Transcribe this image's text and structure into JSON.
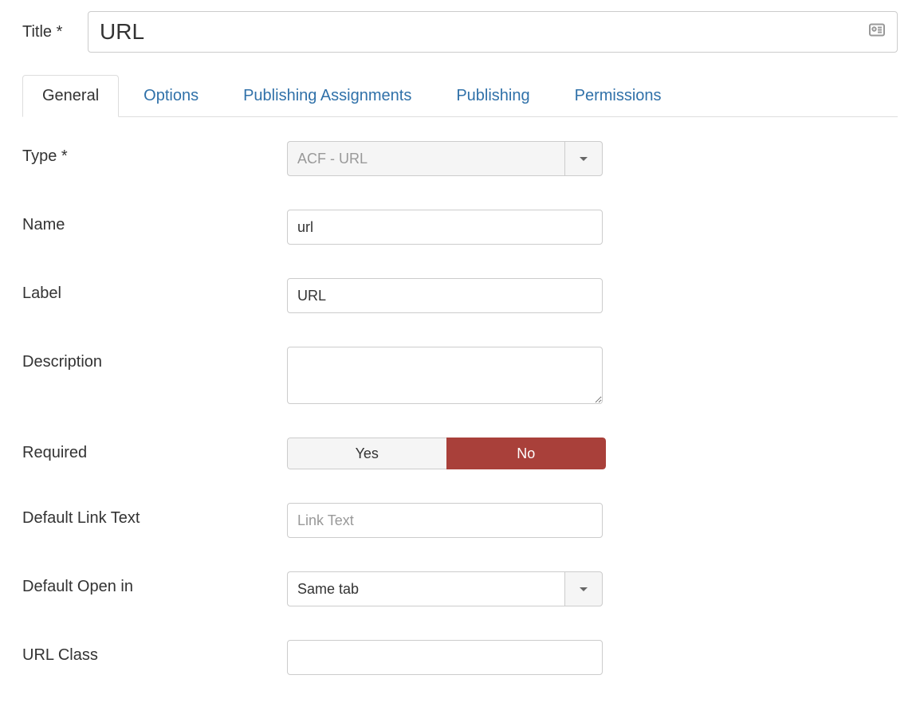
{
  "title": {
    "label": "Title *",
    "value": "URL"
  },
  "tabs": [
    {
      "label": "General",
      "active": true
    },
    {
      "label": "Options",
      "active": false
    },
    {
      "label": "Publishing Assignments",
      "active": false
    },
    {
      "label": "Publishing",
      "active": false
    },
    {
      "label": "Permissions",
      "active": false
    }
  ],
  "form": {
    "type": {
      "label": "Type *",
      "value": "ACF - URL"
    },
    "name": {
      "label": "Name",
      "value": "url"
    },
    "field_label": {
      "label": "Label",
      "value": "URL"
    },
    "description": {
      "label": "Description",
      "value": ""
    },
    "required": {
      "label": "Required",
      "options": [
        "Yes",
        "No"
      ],
      "value": "No"
    },
    "default_link_text": {
      "label": "Default Link Text",
      "placeholder": "Link Text",
      "value": ""
    },
    "default_open_in": {
      "label": "Default Open in",
      "value": "Same tab"
    },
    "url_class": {
      "label": "URL Class",
      "value": ""
    }
  }
}
